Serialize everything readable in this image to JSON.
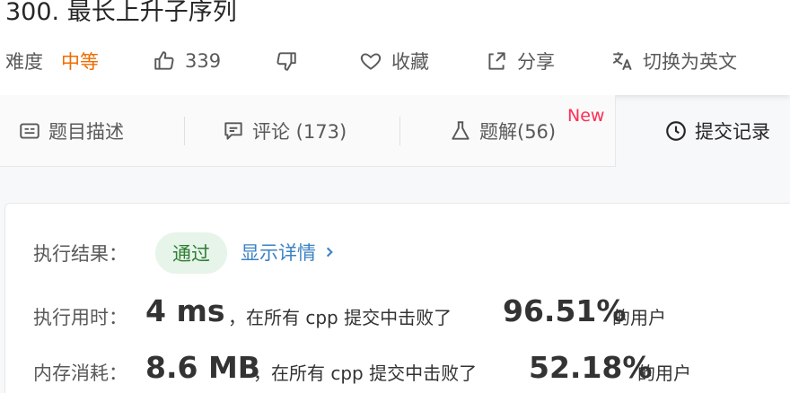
{
  "problem": {
    "title": "300. 最长上升子序列"
  },
  "meta": {
    "difficulty_label": "难度",
    "difficulty_value": "中等",
    "likes": "339",
    "favorite_label": "收藏",
    "share_label": "分享",
    "switch_lang_label": "切换为英文"
  },
  "tabs": [
    {
      "label": "题目描述",
      "icon": "description-icon"
    },
    {
      "label": "评论 (173)",
      "icon": "comment-icon"
    },
    {
      "label": "题解(56)",
      "icon": "flask-icon",
      "badge": "New"
    },
    {
      "label": "提交记录",
      "icon": "clock-icon"
    }
  ],
  "result": {
    "label": "执行结果：",
    "status": "通过",
    "detail_link": "显示详情",
    "runtime_label": "执行用时：",
    "runtime_value": "4 ms",
    "runtime_text": "，在所有 cpp 提交中击败了",
    "runtime_percent": "96.51%",
    "runtime_suffix": "的用户",
    "memory_label": "内存消耗：",
    "memory_value": "8.6 MB",
    "memory_text": "，在所有 cpp 提交中击败了",
    "memory_percent": "52.18%",
    "memory_suffix": "的用户"
  },
  "colors": {
    "accent_orange": "#ef6c00",
    "link_blue": "#3b82c4",
    "success_green": "#2e7d32",
    "new_red": "#ff2d55"
  }
}
